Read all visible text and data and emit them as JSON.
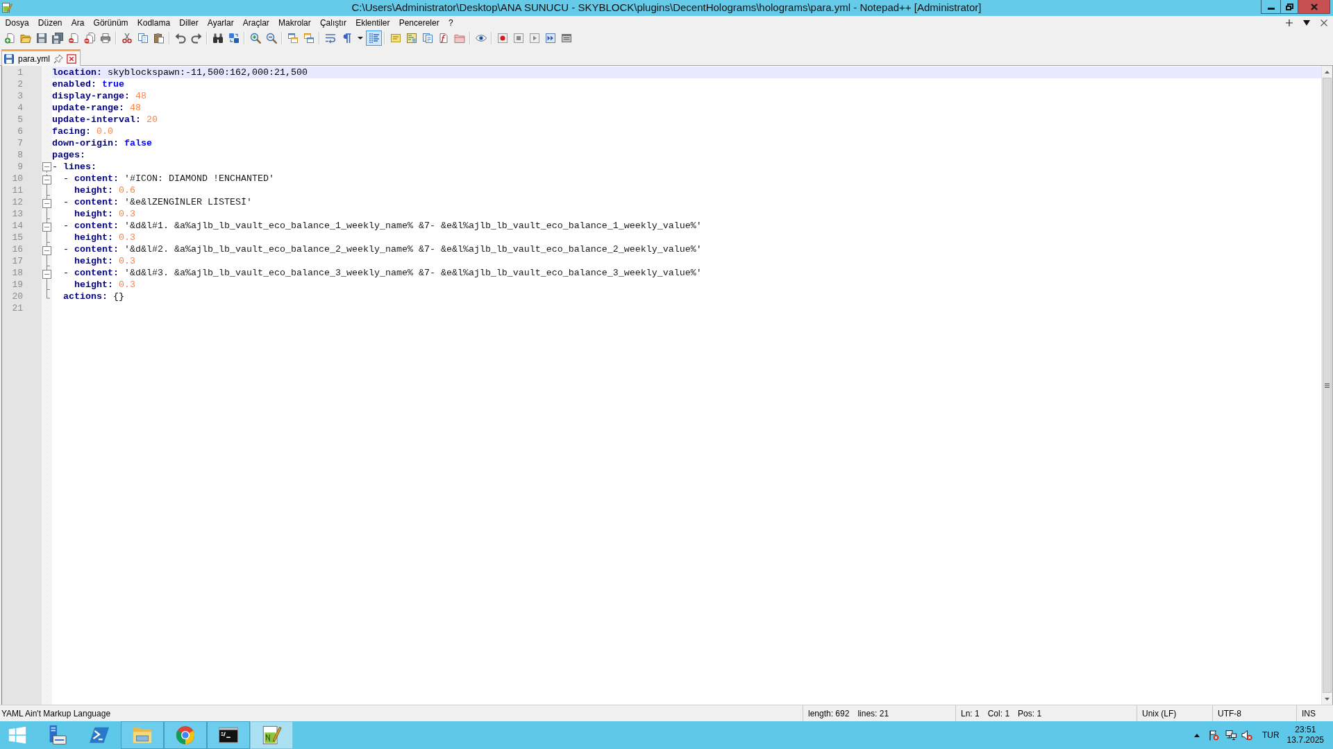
{
  "window": {
    "title": "C:\\Users\\Administrator\\Desktop\\ANA SUNUCU - SKYBLOCK\\plugins\\DecentHolograms\\holograms\\para.yml - Notepad++ [Administrator]"
  },
  "menu": [
    "Dosya",
    "Düzen",
    "Ara",
    "Görünüm",
    "Kodlama",
    "Diller",
    "Ayarlar",
    "Araçlar",
    "Makrolar",
    "Çalıştır",
    "Eklentiler",
    "Pencereler",
    "?"
  ],
  "toolbar": {
    "groups": [
      [
        {
          "on": false
        },
        {
          "on": false
        },
        {
          "on": false
        },
        {
          "on": false
        },
        {
          "on": false
        },
        {
          "on": false
        },
        {
          "on": false
        }
      ],
      [
        {
          "on": false
        },
        {
          "on": false
        },
        {
          "on": false
        }
      ],
      [
        {
          "on": false
        },
        {
          "on": false
        }
      ],
      [
        {
          "on": false
        },
        {
          "on": false
        }
      ],
      [
        {
          "on": false
        },
        {
          "on": false
        }
      ],
      [
        {
          "on": false
        },
        {
          "on": false
        }
      ],
      [
        {
          "on": false
        },
        {
          "on": false
        },
        {
          "on": false
        },
        {
          "on": true
        }
      ],
      [
        {
          "on": false
        },
        {
          "on": false
        },
        {
          "on": false
        },
        {
          "on": false
        },
        {
          "on": false
        }
      ],
      [
        {
          "on": false
        }
      ],
      [
        {
          "on": false
        },
        {
          "on": false
        },
        {
          "on": false
        },
        {
          "on": false
        },
        {
          "on": false
        }
      ]
    ]
  },
  "tabs": [
    {
      "label": "para.yml",
      "selected": true
    }
  ],
  "editor": {
    "lines": [
      {
        "number": "1",
        "current": true,
        "tokens": [
          {
            "kind": "key",
            "text": "location:"
          },
          {
            "kind": "text",
            "text": " skyblockspawn:-11,500:162,000:21,500"
          }
        ]
      },
      {
        "number": "2",
        "current": false,
        "tokens": [
          {
            "kind": "key",
            "text": "enabled:"
          },
          {
            "kind": "keyword",
            "text": " true"
          }
        ]
      },
      {
        "number": "3",
        "current": false,
        "tokens": [
          {
            "kind": "key",
            "text": "display-range:"
          },
          {
            "kind": "number",
            "text": " 48"
          }
        ]
      },
      {
        "number": "4",
        "current": false,
        "tokens": [
          {
            "kind": "key",
            "text": "update-range:"
          },
          {
            "kind": "number",
            "text": " 48"
          }
        ]
      },
      {
        "number": "5",
        "current": false,
        "tokens": [
          {
            "kind": "key",
            "text": "update-interval:"
          },
          {
            "kind": "number",
            "text": " 20"
          }
        ]
      },
      {
        "number": "6",
        "current": false,
        "tokens": [
          {
            "kind": "key",
            "text": "facing:"
          },
          {
            "kind": "number",
            "text": " 0.0"
          }
        ]
      },
      {
        "number": "7",
        "current": false,
        "tokens": [
          {
            "kind": "key",
            "text": "down-origin:"
          },
          {
            "kind": "keyword",
            "text": " false"
          }
        ]
      },
      {
        "number": "8",
        "current": false,
        "tokens": [
          {
            "kind": "key",
            "text": "pages:"
          }
        ]
      },
      {
        "number": "9",
        "current": false,
        "fold_marker": {
          "kind": "box",
          "expanded": true
        },
        "tokens": [
          {
            "kind": "text",
            "text": "- "
          },
          {
            "kind": "key",
            "text": "lines:"
          }
        ]
      },
      {
        "number": "10",
        "current": false,
        "fold_marker": {
          "kind": "box",
          "expanded": true
        },
        "tokens": [
          {
            "kind": "text",
            "text": "  - "
          },
          {
            "kind": "key",
            "text": "content:"
          },
          {
            "kind": "string",
            "text": " '#ICON: DIAMOND !ENCHANTED'"
          }
        ]
      },
      {
        "number": "11",
        "current": false,
        "fold_marker": {
          "kind": "branch"
        },
        "tokens": [
          {
            "kind": "key",
            "text": "    height:"
          },
          {
            "kind": "number",
            "text": " 0.6"
          }
        ]
      },
      {
        "number": "12",
        "current": false,
        "fold_marker": {
          "kind": "box",
          "expanded": true
        },
        "tokens": [
          {
            "kind": "text",
            "text": "  - "
          },
          {
            "kind": "key",
            "text": "content:"
          },
          {
            "kind": "string",
            "text": " '&e&lZENGİNLER LİSTESİ'"
          }
        ]
      },
      {
        "number": "13",
        "current": false,
        "fold_marker": {
          "kind": "branch"
        },
        "tokens": [
          {
            "kind": "key",
            "text": "    height:"
          },
          {
            "kind": "number",
            "text": " 0.3"
          }
        ]
      },
      {
        "number": "14",
        "current": false,
        "fold_marker": {
          "kind": "box",
          "expanded": true
        },
        "tokens": [
          {
            "kind": "text",
            "text": "  - "
          },
          {
            "kind": "key",
            "text": "content:"
          },
          {
            "kind": "string",
            "text": " '&d&l#1. &a%ajlb_lb_vault_eco_balance_1_weekly_name% &7- &e&l%ajlb_lb_vault_eco_balance_1_weekly_value%'"
          }
        ]
      },
      {
        "number": "15",
        "current": false,
        "fold_marker": {
          "kind": "branch"
        },
        "tokens": [
          {
            "kind": "key",
            "text": "    height:"
          },
          {
            "kind": "number",
            "text": " 0.3"
          }
        ]
      },
      {
        "number": "16",
        "current": false,
        "fold_marker": {
          "kind": "box",
          "expanded": true
        },
        "tokens": [
          {
            "kind": "text",
            "text": "  - "
          },
          {
            "kind": "key",
            "text": "content:"
          },
          {
            "kind": "string",
            "text": " '&d&l#2. &a%ajlb_lb_vault_eco_balance_2_weekly_name% &7- &e&l%ajlb_lb_vault_eco_balance_2_weekly_value%'"
          }
        ]
      },
      {
        "number": "17",
        "current": false,
        "fold_marker": {
          "kind": "branch"
        },
        "tokens": [
          {
            "kind": "key",
            "text": "    height:"
          },
          {
            "kind": "number",
            "text": " 0.3"
          }
        ]
      },
      {
        "number": "18",
        "current": false,
        "fold_marker": {
          "kind": "box",
          "expanded": true
        },
        "tokens": [
          {
            "kind": "text",
            "text": "  - "
          },
          {
            "kind": "key",
            "text": "content:"
          },
          {
            "kind": "string",
            "text": " '&d&l#3. &a%ajlb_lb_vault_eco_balance_3_weekly_name% &7- &e&l%ajlb_lb_vault_eco_balance_3_weekly_value%'"
          }
        ]
      },
      {
        "number": "19",
        "current": false,
        "fold_marker": {
          "kind": "branch"
        },
        "tokens": [
          {
            "kind": "key",
            "text": "    height:"
          },
          {
            "kind": "number",
            "text": " 0.3"
          }
        ]
      },
      {
        "number": "20",
        "current": false,
        "fold_marker": {
          "kind": "end"
        },
        "tokens": [
          {
            "kind": "key",
            "text": "  actions:"
          },
          {
            "kind": "text",
            "text": " {}"
          }
        ]
      },
      {
        "number": "21",
        "current": false
      }
    ]
  },
  "status_bar": {
    "language": "YAML Ain't Markup Language",
    "length": "length: 692",
    "lines": "lines: 21",
    "ln": "Ln: 1",
    "col": "Col: 1",
    "pos": "Pos: 1",
    "eol": "Unix (LF)",
    "encoding": "UTF-8",
    "mode": "INS"
  },
  "taskbar": {
    "apps": [
      {
        "running": false,
        "active": false
      },
      {
        "running": false,
        "active": false
      },
      {
        "running": true,
        "active": false
      },
      {
        "running": true,
        "active": false
      },
      {
        "running": true,
        "active": false
      },
      {
        "running": true,
        "active": true
      }
    ]
  },
  "tray": {
    "input_language": "TUR",
    "time": "23:51",
    "date": "13.7.2025"
  }
}
